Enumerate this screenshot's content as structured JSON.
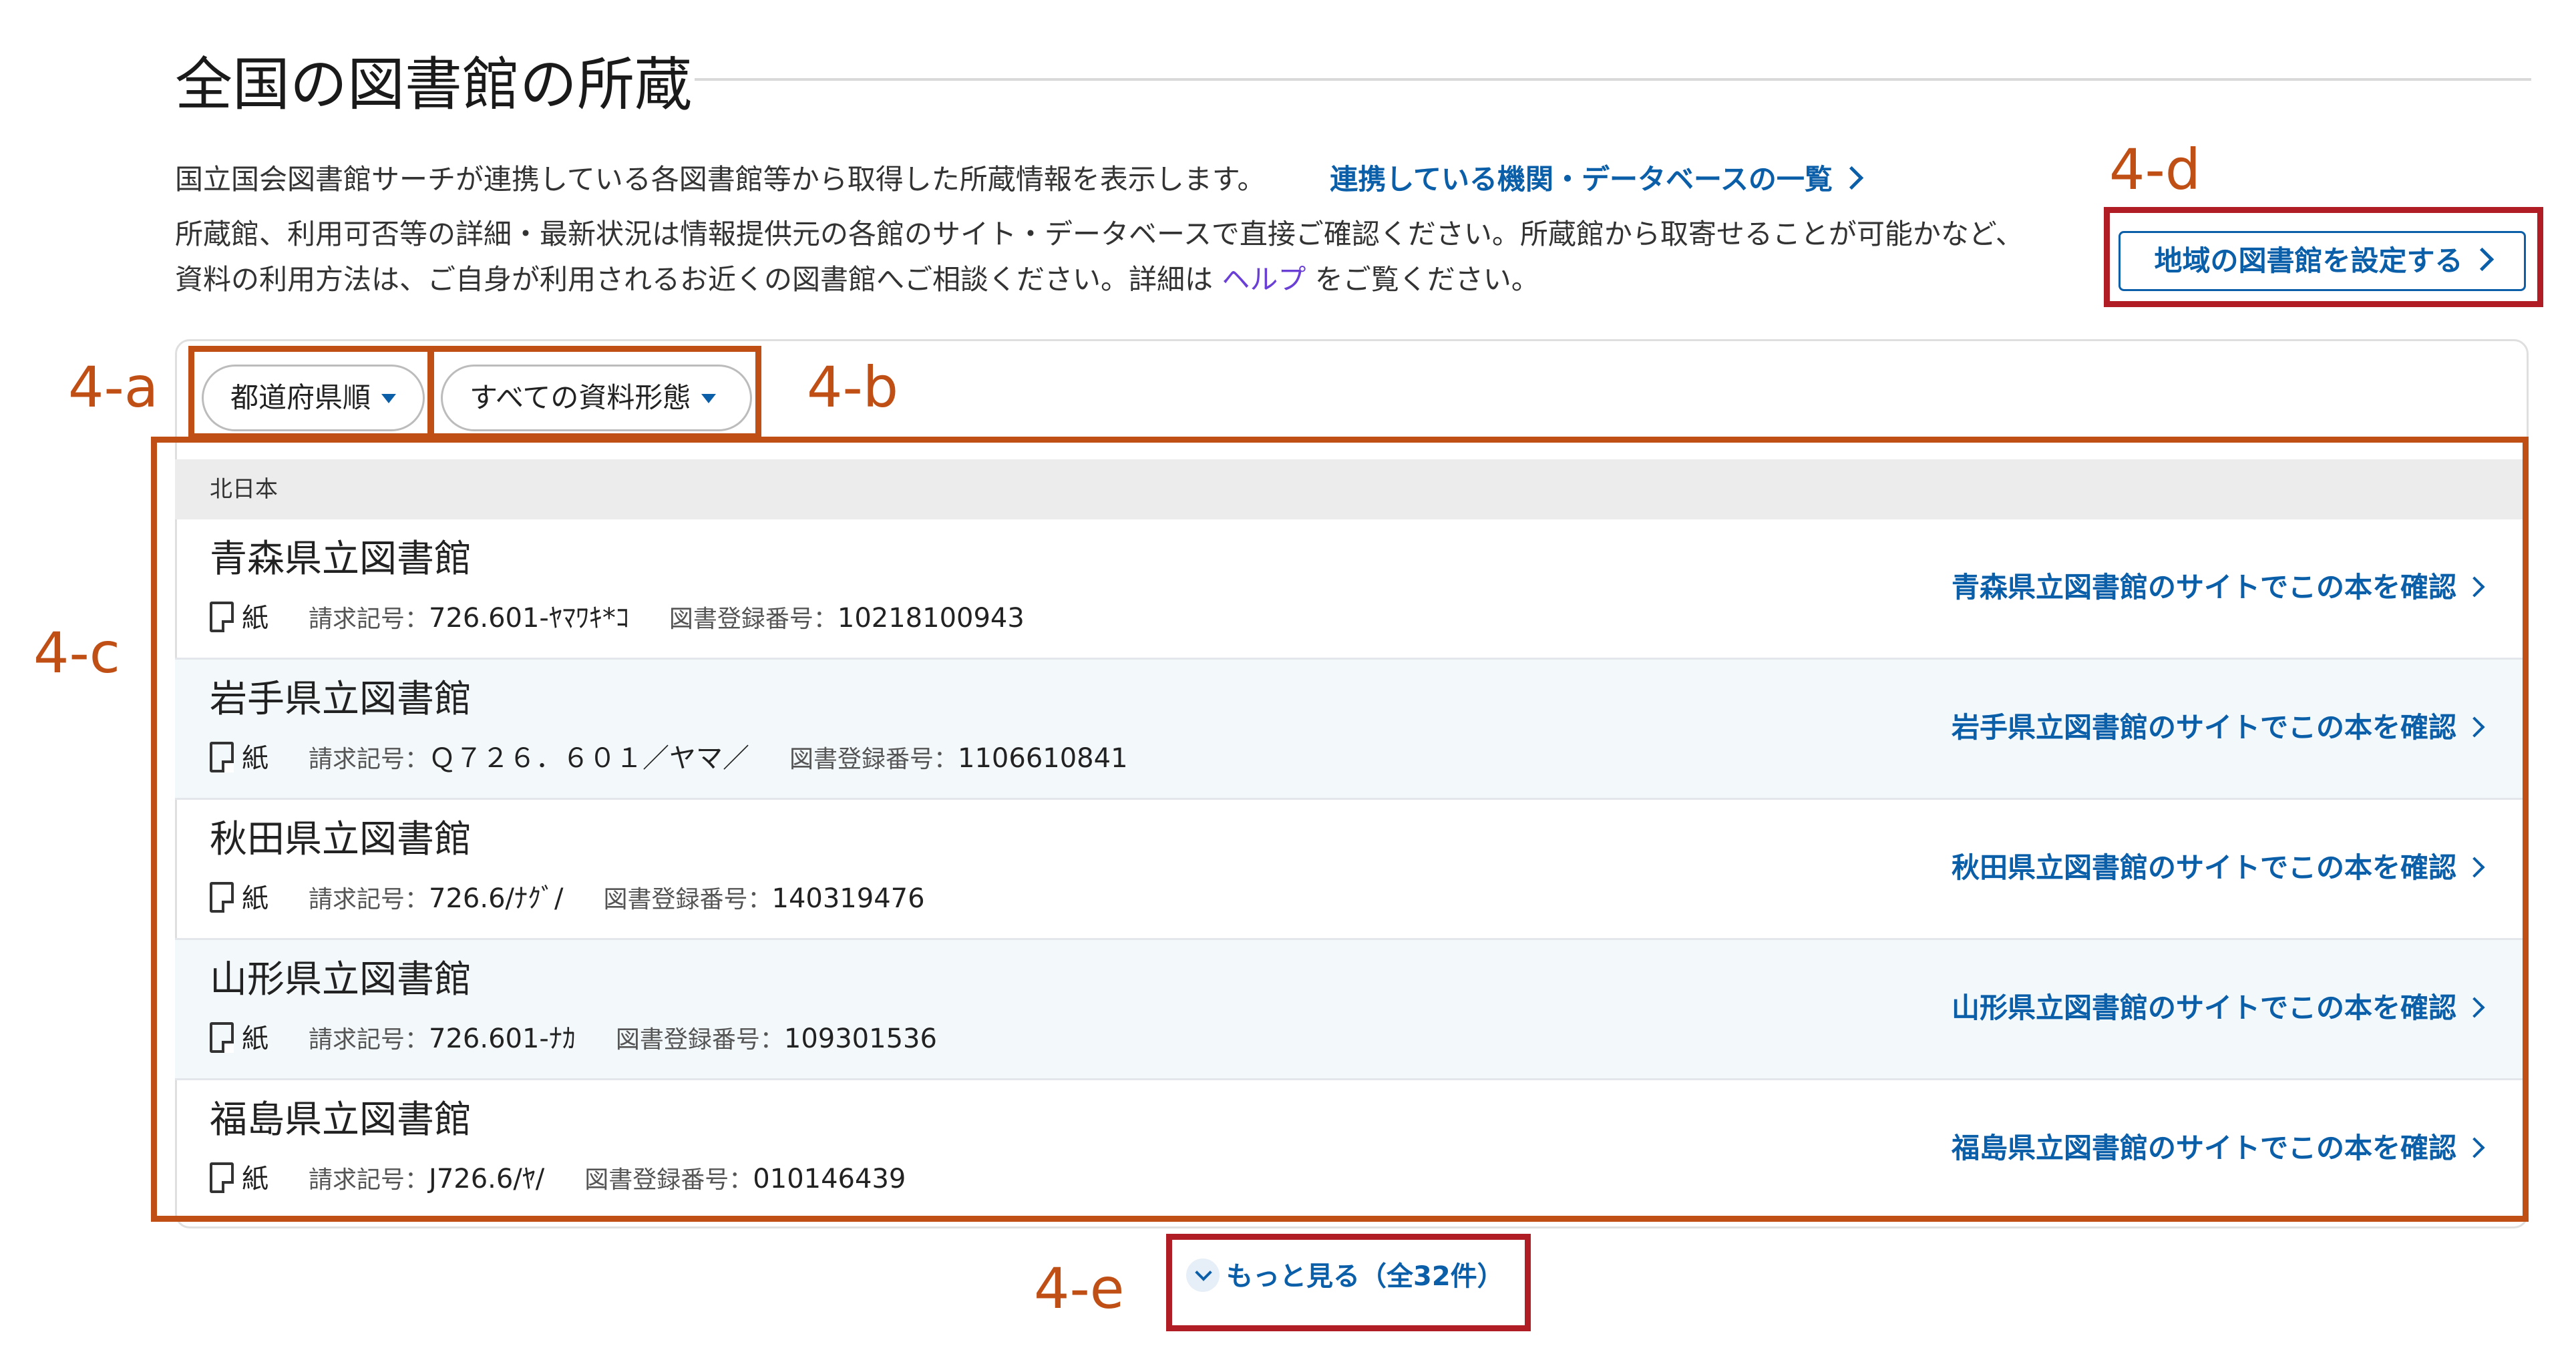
{
  "heading": "全国の図書館の所蔵",
  "intro": {
    "line1": "国立国会図書館サーチが連携している各図書館等から取得した所蔵情報を表示します。",
    "line1_link": "連携している機関・データベースの一覧",
    "line2": "所蔵館、利用可否等の詳細・最新状況は情報提供元の各館のサイト・データベースで直接ご確認ください。所蔵館から取寄せることが可能かなど、",
    "line3_before": "資料の利用方法は、ご自身が利用されるお近くの図書館へご相談ください。詳細は",
    "line3_link": "ヘルプ",
    "line3_after": "をご覧ください。"
  },
  "region_button": "地域の図書館を設定する",
  "filters": {
    "sort": "都道府県順",
    "material_type": "すべての資料形態"
  },
  "group_label": "北日本",
  "call_number_label": "請求記号：",
  "registration_label": "図書登録番号：",
  "libraries": [
    {
      "name": "青森県立図書館",
      "format": "紙",
      "call_number": "726.601-ﾔﾏﾜｷ*ｺ",
      "registration": "10218100943",
      "link": "青森県立図書館のサイトでこの本を確認"
    },
    {
      "name": "岩手県立図書館",
      "format": "紙",
      "call_number": "Ｑ７２６．６０１／ヤマ／",
      "registration": "1106610841",
      "link": "岩手県立図書館のサイトでこの本を確認"
    },
    {
      "name": "秋田県立図書館",
      "format": "紙",
      "call_number": "726.6/ﾅｸﾞ/",
      "registration": "140319476",
      "link": "秋田県立図書館のサイトでこの本を確認"
    },
    {
      "name": "山形県立図書館",
      "format": "紙",
      "call_number": "726.601-ﾅｶ",
      "registration": "109301536",
      "link": "山形県立図書館のサイトでこの本を確認"
    },
    {
      "name": "福島県立図書館",
      "format": "紙",
      "call_number": "J726.6/ﾔ/",
      "registration": "010146439",
      "link": "福島県立図書館のサイトでこの本を確認"
    }
  ],
  "more_button": "もっと見る（全32件）",
  "annotations": {
    "a": "4-a",
    "b": "4-b",
    "c": "4-c",
    "d": "4-d",
    "e": "4-e"
  },
  "colors": {
    "link": "#0b5ea8",
    "annotation_box_red": "#b11d24",
    "annotation_box_orange": "#c04f16"
  }
}
